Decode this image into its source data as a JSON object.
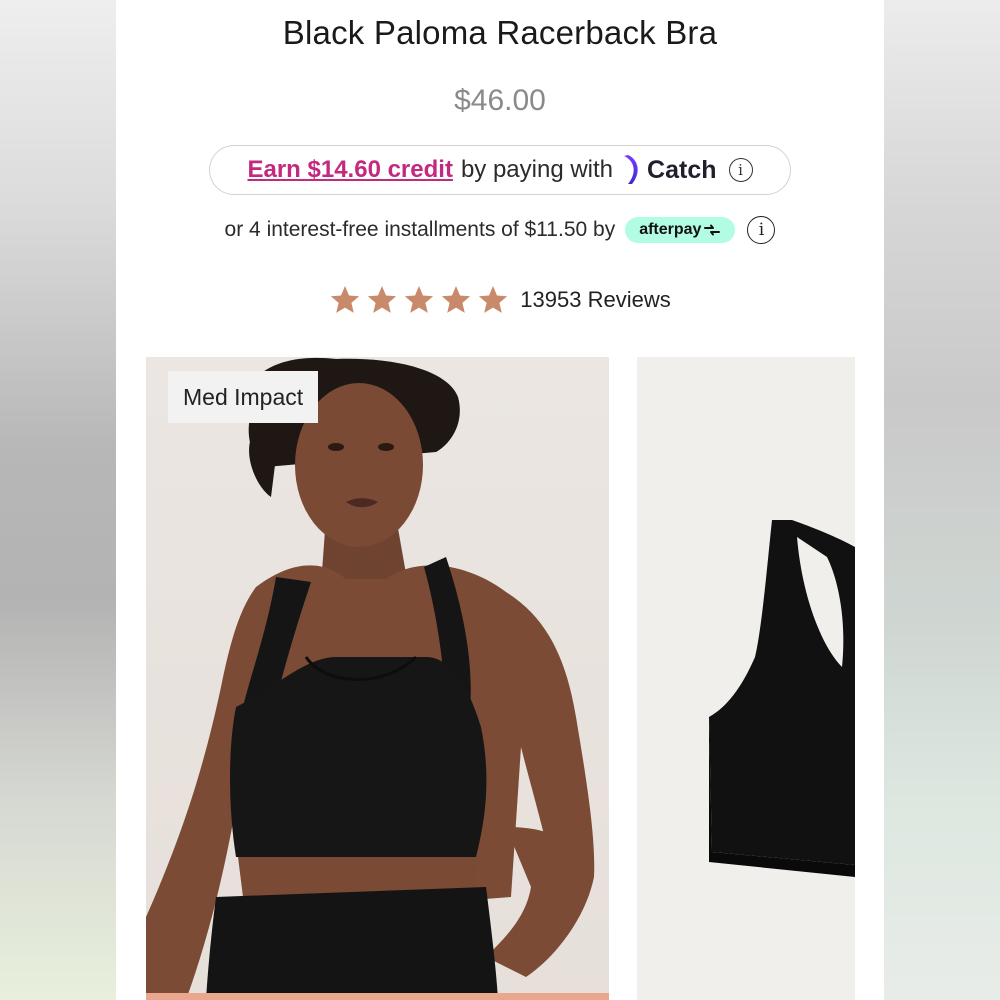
{
  "product": {
    "title": "Black Paloma Racerback Bra",
    "price": "$46.00"
  },
  "catch_offer": {
    "earn_link": "Earn $14.60 credit",
    "by_text": "by paying with",
    "brand": "Catch",
    "info_glyph": "i",
    "link_color": "#c2297f"
  },
  "afterpay": {
    "text": "or 4 interest-free installments of $11.50 by",
    "badge": "afterpay",
    "badge_color": "#b2fce4",
    "info_glyph": "i"
  },
  "rating": {
    "stars": 5,
    "max_stars": 5,
    "star_color": "#c98a6b",
    "reviews": "13953 Reviews"
  },
  "gallery": {
    "main_tag": "Med Impact",
    "images": [
      "model-wearing-black-racerback-bra",
      "black-racerback-bra-flat-lay"
    ]
  }
}
